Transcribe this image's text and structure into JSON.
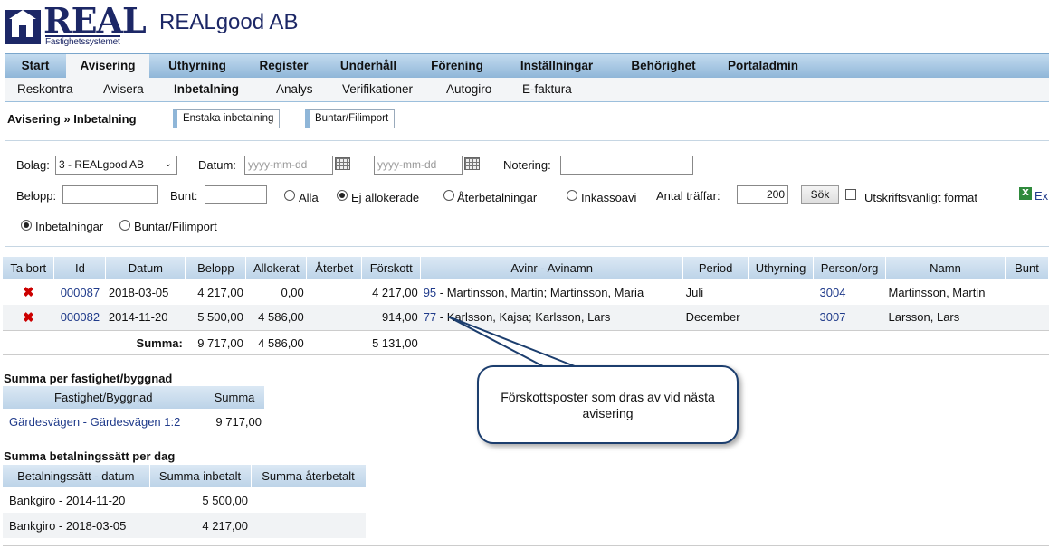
{
  "header": {
    "logo_text": "REAL",
    "logo_sub": "Fastighetssystemet",
    "company": "REALgood AB"
  },
  "topnav": [
    "Start",
    "Avisering",
    "Uthyrning",
    "Register",
    "Underhåll",
    "Förening",
    "Inställningar",
    "Behörighet",
    "Portaladmin"
  ],
  "subnav": [
    "Reskontra",
    "Avisera",
    "Inbetalning",
    "Analys",
    "Verifikationer",
    "Autogiro",
    "E-faktura"
  ],
  "breadcrumb": "Avisering » Inbetalning",
  "buttons": {
    "single": "Enstaka inbetalning",
    "bundles": "Buntar/Filimport",
    "search": "Sök",
    "export": "Ex"
  },
  "filters": {
    "bolag_label": "Bolag:",
    "bolag_value": "3 - REALgood AB",
    "datum_label": "Datum:",
    "date_placeholder": "yyyy-mm-dd",
    "notering_label": "Notering:",
    "belopp_label": "Belopp:",
    "bunt_label": "Bunt:",
    "radio_all": "Alla",
    "radio_unallocated": "Ej allokerade",
    "radio_refunds": "Återbetalningar",
    "radio_debt": "Inkassoavi",
    "hits_label": "Antal träffar:",
    "hits_value": "200",
    "print_label": "Utskriftsvänligt format",
    "radio_payments": "Inbetalningar",
    "radio_bundles": "Buntar/Filimport"
  },
  "main_table": {
    "headers": [
      "Ta bort",
      "Id",
      "Datum",
      "Belopp",
      "Allokerat",
      "Återbet",
      "Förskott",
      "Avinr - Avinamn",
      "Period",
      "Uthyrning",
      "Person/org",
      "Namn",
      "Bunt"
    ],
    "rows": [
      {
        "del": "✖",
        "id": "000087",
        "date": "2018-03-05",
        "amount": "4 217,00",
        "allocated": "0,00",
        "refund": "",
        "advance": "4 217,00",
        "avinr": "95",
        "avinamn": " - Martinsson, Martin; Martinsson, Maria",
        "period": "Juli",
        "rental": "",
        "person": "3004",
        "name": "Martinsson, Martin",
        "bunt": ""
      },
      {
        "del": "✖",
        "id": "000082",
        "date": "2014-11-20",
        "amount": "5 500,00",
        "allocated": "4 586,00",
        "refund": "",
        "advance": "914,00",
        "avinr": "77",
        "avinamn": " - Karlsson, Kajsa; Karlsson, Lars",
        "period": "December",
        "rental": "",
        "person": "3007",
        "name": "Larsson, Lars",
        "bunt": ""
      }
    ],
    "sum": {
      "label": "Summa:",
      "amount": "9 717,00",
      "allocated": "4 586,00",
      "advance": "5 131,00"
    }
  },
  "property_summary": {
    "title": "Summa per fastighet/byggnad",
    "headers": [
      "Fastighet/Byggnad",
      "Summa"
    ],
    "rows": [
      {
        "name": "Gärdesvägen - Gärdesvägen 1:2",
        "sum": "9 717,00"
      }
    ]
  },
  "payment_summary": {
    "title": "Summa betalningssätt per dag",
    "headers": [
      "Betalningssätt - datum",
      "Summa inbetalt",
      "Summa återbetalt"
    ],
    "rows": [
      {
        "method": "Bankgiro - 2014-11-20",
        "paid": "5 500,00",
        "refunded": ""
      },
      {
        "method": "Bankgiro - 2018-03-05",
        "paid": "4 217,00",
        "refunded": ""
      }
    ]
  },
  "callout": "Förskottsposter som dras av vid nästa avisering"
}
